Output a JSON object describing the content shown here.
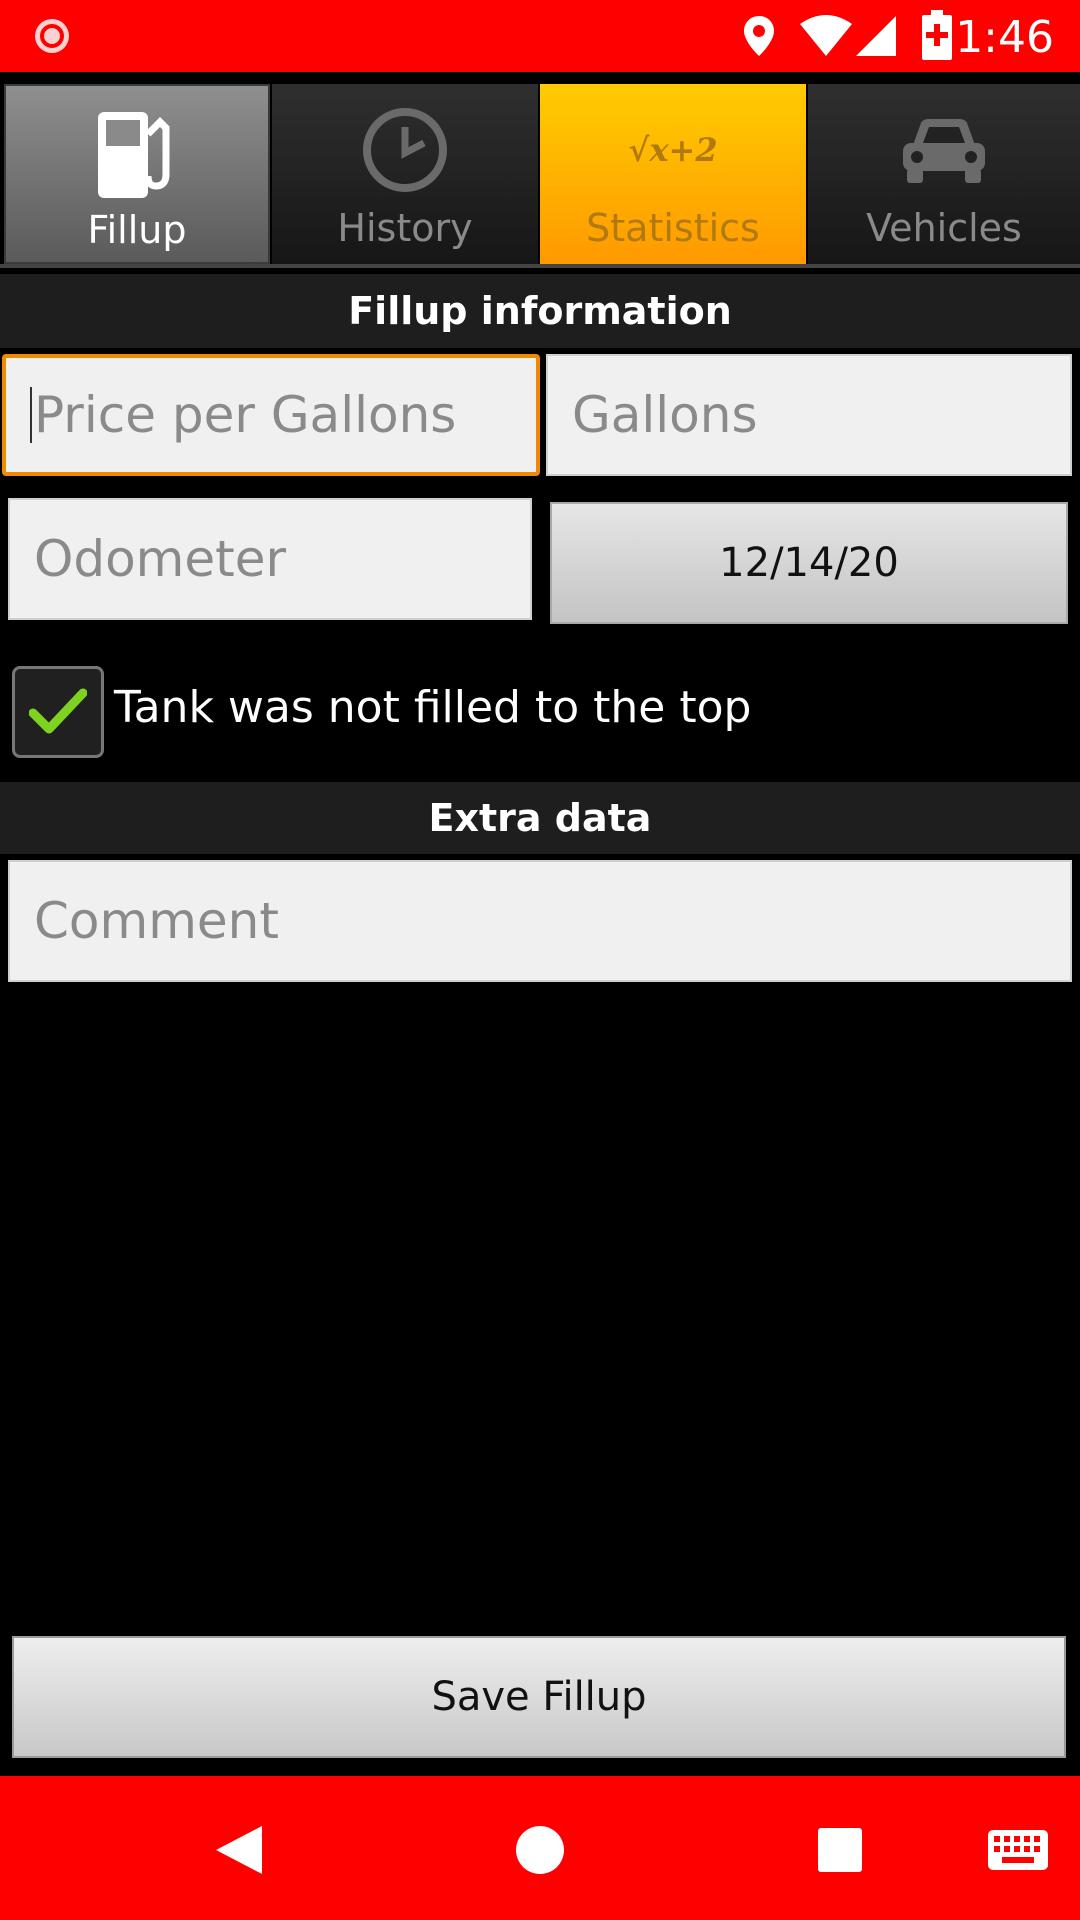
{
  "status_bar": {
    "time": "1:46",
    "icons": [
      "record-icon",
      "location-icon",
      "wifi-icon",
      "signal-icon",
      "battery-icon"
    ],
    "color": "#ff0000"
  },
  "tabs": [
    {
      "label": "Fillup",
      "icon": "fuel-pump-icon",
      "state": "selected"
    },
    {
      "label": "History",
      "icon": "clock-icon",
      "state": "normal"
    },
    {
      "label": "Statistics",
      "icon": "sqrt-icon",
      "icon_text": "√x+2",
      "state": "highlighted"
    },
    {
      "label": "Vehicles",
      "icon": "car-icon",
      "state": "normal"
    }
  ],
  "sections": {
    "fillup_header": "Fillup information",
    "extra_header": "Extra data"
  },
  "form": {
    "price_per_gallon": {
      "value": "",
      "placeholder": "Price per Gallons"
    },
    "gallons": {
      "value": "",
      "placeholder": "Gallons"
    },
    "odometer": {
      "value": "",
      "placeholder": "Odometer"
    },
    "date": "12/14/20",
    "partial_fill": {
      "label": "Tank was not filled to the top",
      "checked": true
    },
    "comment": {
      "value": "",
      "placeholder": "Comment"
    }
  },
  "save_button": "Save Fillup",
  "nav_bar": {
    "icons": [
      "back-icon",
      "home-icon",
      "recents-icon",
      "keyboard-icon"
    ],
    "color": "#ff0000"
  },
  "colors": {
    "accent_orange": "#f08a00",
    "statistics_tab": "#ffb300",
    "check_green": "#7ed321"
  }
}
